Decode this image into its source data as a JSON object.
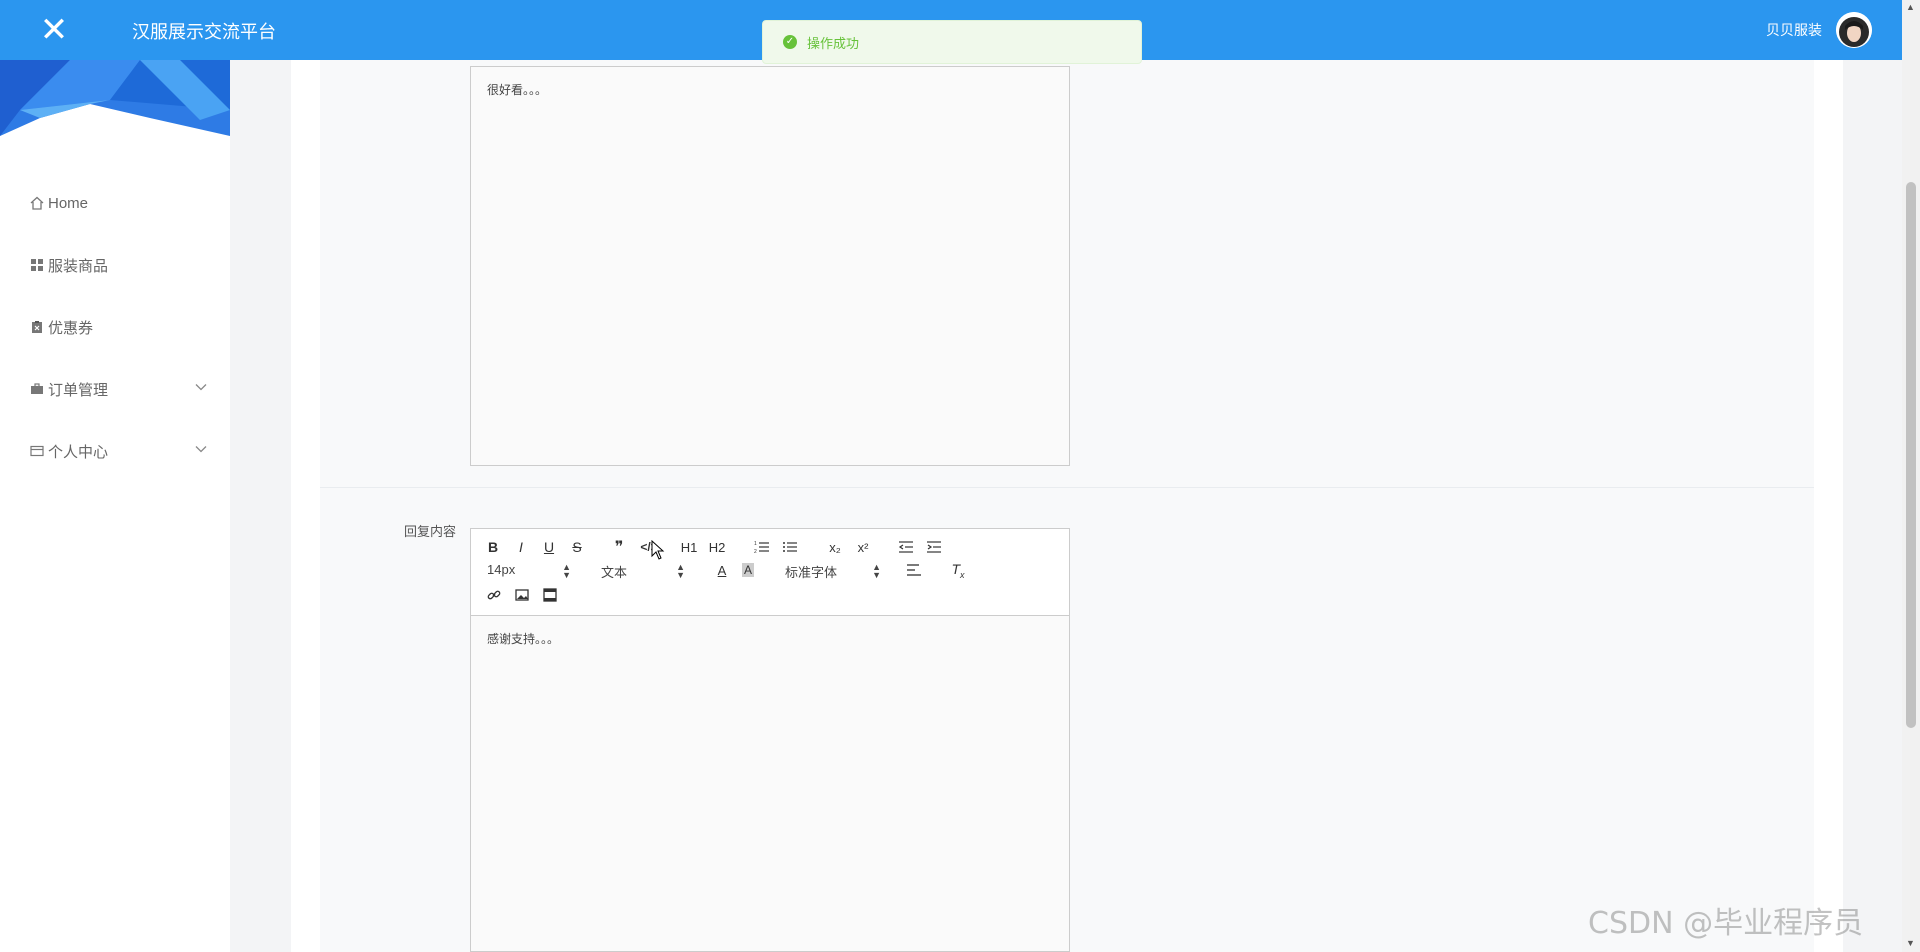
{
  "header": {
    "app_title": "汉服展示交流平台",
    "user_name": "贝贝服装"
  },
  "toast": {
    "message": "操作成功",
    "type": "success"
  },
  "sidebar": {
    "items": [
      {
        "label": "Home",
        "icon": "home-icon",
        "expandable": false
      },
      {
        "label": "服装商品",
        "icon": "grid-icon",
        "expandable": false
      },
      {
        "label": "优惠券",
        "icon": "clipboard-icon",
        "expandable": false
      },
      {
        "label": "订单管理",
        "icon": "briefcase-icon",
        "expandable": true
      },
      {
        "label": "个人中心",
        "icon": "credit-card-icon",
        "expandable": true
      }
    ]
  },
  "form": {
    "review_content": "很好看。。。",
    "reply_label": "回复内容",
    "reply_content": "感谢支持。。。"
  },
  "toolbar": {
    "bold": "B",
    "italic": "I",
    "underline": "U",
    "strike": "S",
    "blockquote": "❞",
    "code": "</>",
    "h1": "H1",
    "h2": "H2",
    "subscript": "x₂",
    "superscript": "x²",
    "font_size": "14px",
    "header_select": "文本",
    "font_family": "标准字体"
  },
  "watermark": "CSDN @毕业程序员",
  "colors": {
    "topbar": "#2b96ef",
    "success": "#67c23a"
  }
}
